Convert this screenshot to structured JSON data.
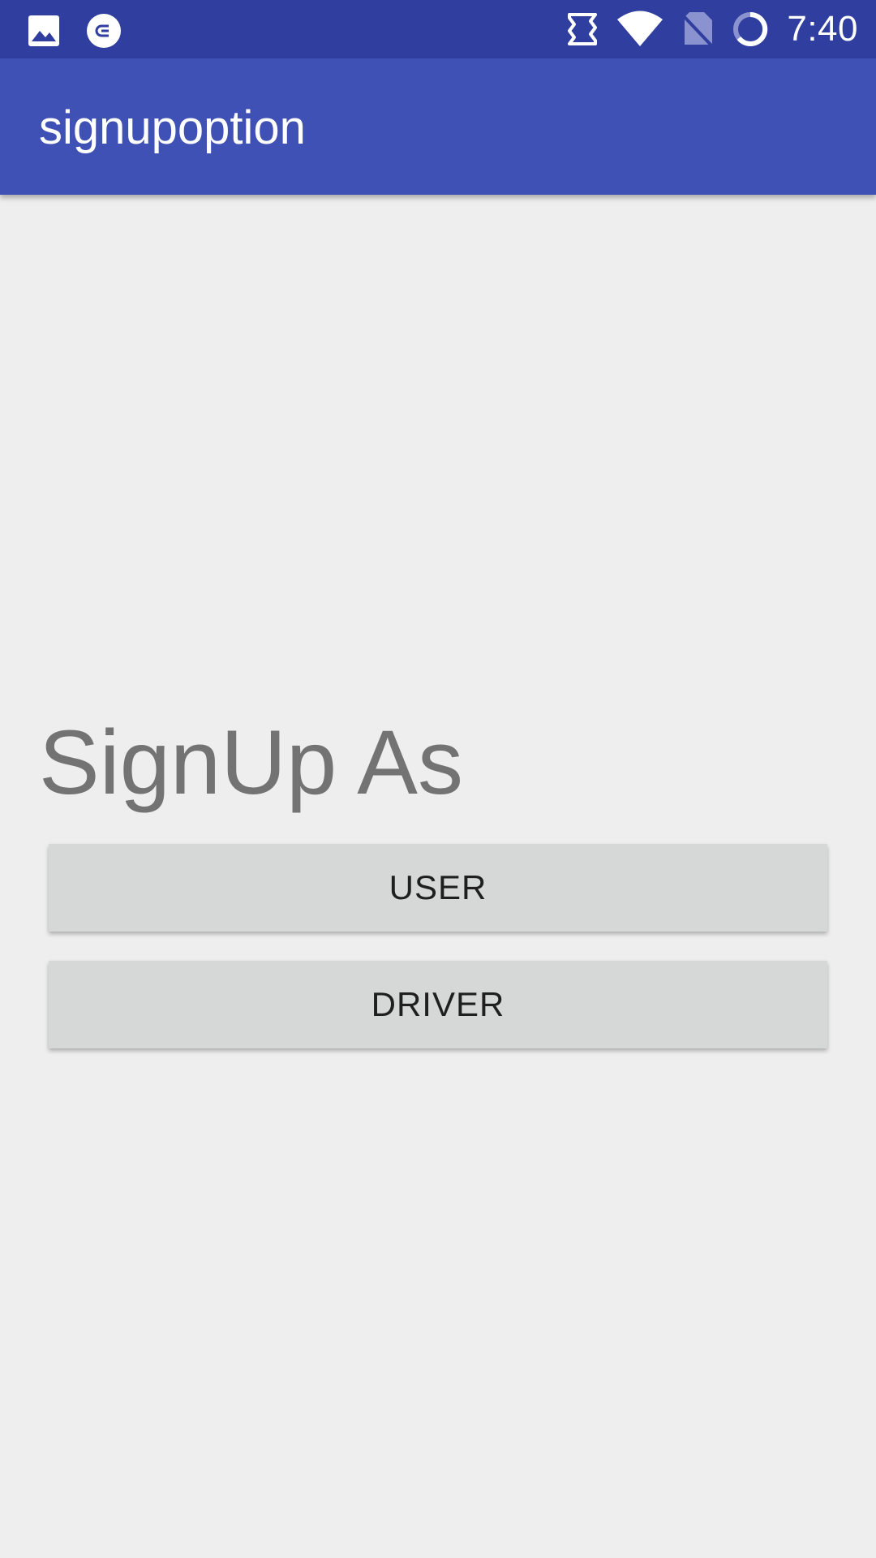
{
  "status_bar": {
    "time": "7:40",
    "background": "#303f9f",
    "left_icons": [
      "image-icon",
      "circle-link-icon"
    ],
    "right_icons": [
      "nfc-icon",
      "wifi-icon",
      "no-sim-icon",
      "battery-ring-icon"
    ]
  },
  "app_bar": {
    "title": "signupoption",
    "background": "#3f51b5"
  },
  "main": {
    "heading": "SignUp As",
    "buttons": [
      {
        "label": "USER"
      },
      {
        "label": "DRIVER"
      }
    ]
  },
  "colors": {
    "page_background": "#eeeeee",
    "button_background": "#d6d7d7",
    "heading_text": "#737373"
  }
}
